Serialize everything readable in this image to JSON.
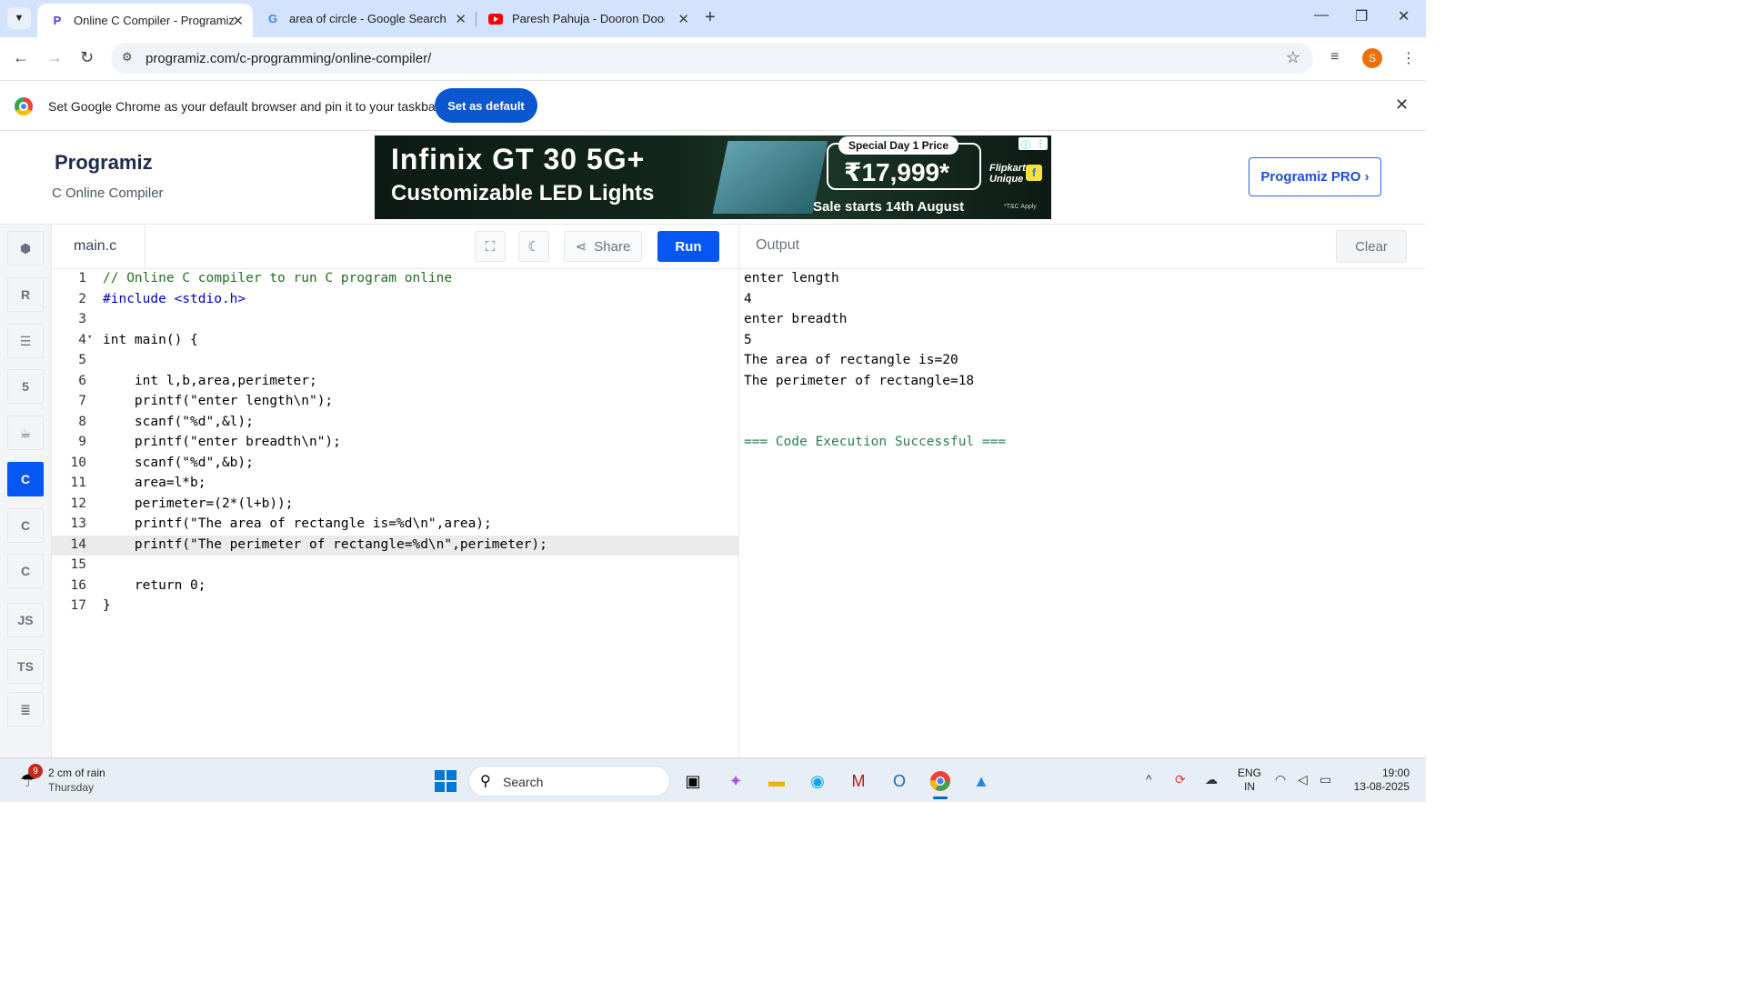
{
  "browser": {
    "tabs": [
      {
        "title": "Online C Compiler - Programiz",
        "favicon": "programiz-icon",
        "active": true
      },
      {
        "title": "area of circle - Google Search",
        "favicon": "google-icon",
        "active": false
      },
      {
        "title": "Paresh Pahuja - Dooron Dooron",
        "favicon": "youtube-icon",
        "active": false
      }
    ],
    "url": "programiz.com/c-programming/online-compiler/",
    "profile_initial": "S"
  },
  "infobar": {
    "message": "Set Google Chrome as your default browser and pin it to your taskbar",
    "button": "Set as default"
  },
  "site": {
    "logo": "Programiz",
    "subtitle": "C Online Compiler",
    "pro_button": "Programiz PRO ›"
  },
  "ad": {
    "line1": "Infinix  GT 30 5G+",
    "line2": "Customizable LED Lights",
    "special": "Special Day 1 Price",
    "price": "₹17,999*",
    "sale": "Sale starts 14th August",
    "brand": "Flipkart Unique",
    "tc": "*T&C Apply"
  },
  "rail": {
    "items": [
      {
        "name": "python",
        "icon": "python-icon",
        "label": "🐍"
      },
      {
        "name": "r",
        "icon": "r-icon",
        "label": "R"
      },
      {
        "name": "sql",
        "icon": "database-icon",
        "label": "≣"
      },
      {
        "name": "html",
        "icon": "html5-icon",
        "label": "5"
      },
      {
        "name": "java",
        "icon": "java-icon",
        "label": "☕"
      },
      {
        "name": "c",
        "icon": "c-icon",
        "label": "C",
        "active": true
      },
      {
        "name": "cpp",
        "icon": "cpp-icon",
        "label": "C"
      },
      {
        "name": "csharp",
        "icon": "csharp-icon",
        "label": "C"
      },
      {
        "name": "js",
        "icon": "js-icon",
        "label": "JS"
      },
      {
        "name": "ts",
        "icon": "ts-icon",
        "label": "TS"
      },
      {
        "name": "go",
        "icon": "go-icon",
        "label": "≡"
      }
    ]
  },
  "editor": {
    "filename": "main.c",
    "share_label": "Share",
    "run_label": "Run",
    "lines": [
      "// Online C compiler to run C program online",
      "#include <stdio.h>",
      "",
      "int main() {",
      "",
      "    int l,b,area,perimeter;",
      "    printf(\"enter length\\n\");",
      "    scanf(\"%d\",&l);",
      "    printf(\"enter breadth\\n\");",
      "    scanf(\"%d\",&b);",
      "    area=l*b;",
      "    perimeter=(2*(l+b));",
      "    printf(\"The area of rectangle is=%d\\n\",area);",
      "    printf(\"The perimeter of rectangle=%d\\n\",perimeter);",
      "",
      "    return 0;",
      "}"
    ],
    "highlighted_line": 14
  },
  "output": {
    "title": "Output",
    "clear_label": "Clear",
    "lines": [
      "enter length",
      "4",
      "enter breadth",
      "5",
      "The area of rectangle is=20",
      "The perimeter of rectangle=18",
      "",
      "",
      "=== Code Execution Successful ==="
    ]
  },
  "taskbar": {
    "weather_badge": "9",
    "weather_line1": "2 cm of rain",
    "weather_line2": "Thursday",
    "search_placeholder": "Search",
    "lang_line1": "ENG",
    "lang_line2": "IN",
    "time": "19:00",
    "date": "13-08-2025"
  }
}
